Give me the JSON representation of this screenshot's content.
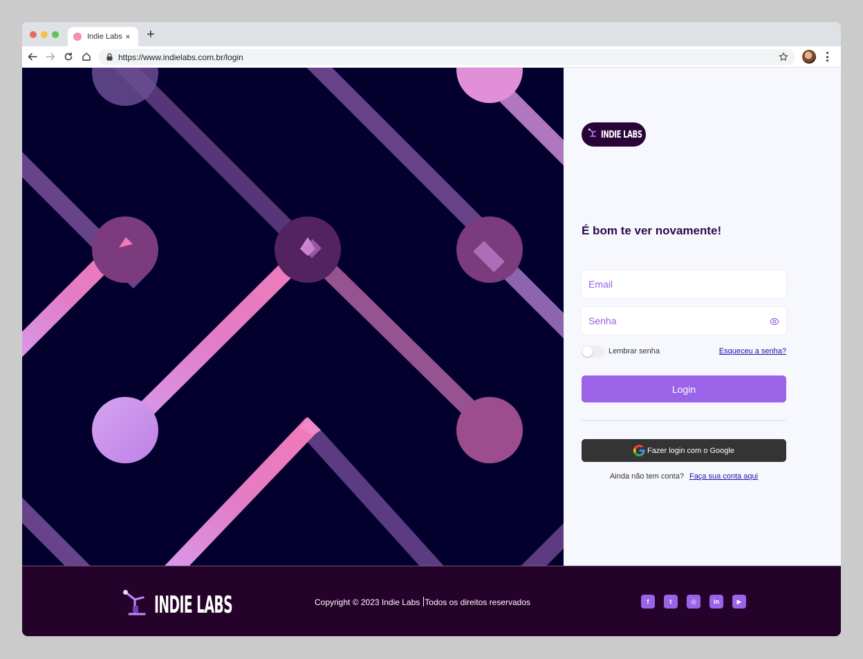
{
  "browser": {
    "tab_title": "Indie Labs",
    "tab_close": "×",
    "new_tab": "+",
    "url": "https://www.indielabs.com.br/login"
  },
  "brand": {
    "logo_text": "INDIE LABS",
    "accent_color": "#9b63e8",
    "dark_color": "#250229",
    "art_background": "#03002e"
  },
  "login": {
    "heading": "É bom te ver novamente!",
    "email_placeholder": "Email",
    "password_placeholder": "Senha",
    "remember_label": "Lembrar senha",
    "remember_checked": false,
    "forgot_link": "Esqueceu a senha?",
    "login_button": "Login",
    "google_button": "Fazer login com o Google",
    "signup_prompt": "Ainda não tem conta?",
    "signup_link": "Faça sua conta aqui"
  },
  "footer": {
    "copyright": "Copyright © 2023 Indie Labs",
    "rights": "Todos os direitos reservados",
    "social": [
      {
        "name": "facebook",
        "glyph": "f"
      },
      {
        "name": "twitter",
        "glyph": "t"
      },
      {
        "name": "instagram",
        "glyph": "◎"
      },
      {
        "name": "linkedin",
        "glyph": "in"
      },
      {
        "name": "youtube",
        "glyph": "▶"
      }
    ]
  }
}
